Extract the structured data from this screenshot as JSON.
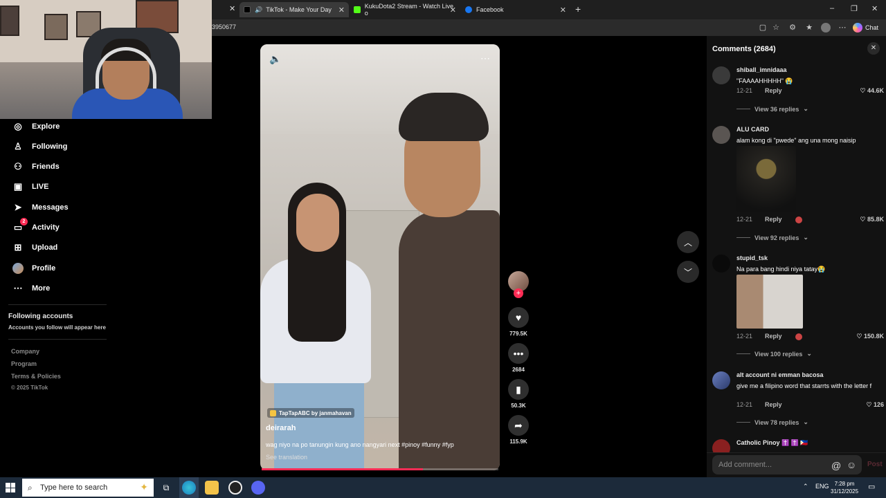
{
  "browser": {
    "tabs": [
      {
        "title": "TikTok - Make Your Day",
        "active": true
      },
      {
        "title": "KukuDota2 Stream - Watch Live o",
        "active": false
      },
      {
        "title": "Facebook",
        "active": false
      }
    ],
    "url_fragment": "3950677",
    "chat_label": "Chat",
    "new_tab_icon": "plus-icon"
  },
  "sidebar": {
    "items": [
      {
        "label": "Explore",
        "icon": "compass-icon"
      },
      {
        "label": "Following",
        "icon": "person-check-icon"
      },
      {
        "label": "Friends",
        "icon": "people-icon"
      },
      {
        "label": "LIVE",
        "icon": "live-tv-icon"
      },
      {
        "label": "Messages",
        "icon": "paper-plane-icon"
      },
      {
        "label": "Activity",
        "icon": "bell-message-icon",
        "badge": "2"
      },
      {
        "label": "Upload",
        "icon": "plus-square-icon"
      },
      {
        "label": "Profile",
        "icon": "profile-avatar-icon"
      },
      {
        "label": "More",
        "icon": "ellipsis-icon"
      }
    ],
    "following_title": "Following accounts",
    "following_sub": "Accounts you follow will appear here",
    "footer": {
      "company": "Company",
      "program": "Program",
      "terms": "Terms & Policies",
      "copyright": "© 2025 TikTok"
    }
  },
  "video": {
    "source_tag": "TapTapABC by janmahavan",
    "author": "deirarah",
    "caption": "wag niyo na po tanungin kung ano nangyari next #pinoy #funny #fyp",
    "see_translation": "See translation",
    "progress": 0.68
  },
  "actions": {
    "likes": "779.5K",
    "comments": "2684",
    "saves": "50.3K",
    "shares": "115.9K"
  },
  "comments": {
    "title": "Comments (2684)",
    "items": [
      {
        "user": "shiball_imnidaaa",
        "text": "\"FAAAAHHHHH\" 😭",
        "date": "12-21",
        "reply": "Reply",
        "likes": "44.6K",
        "view_replies": "View 36 replies"
      },
      {
        "user": "ALU CARD",
        "text": "alam kong di \"pwede\" ang una mong naisip",
        "date": "12-21",
        "reply": "Reply",
        "likes": "85.8K",
        "view_replies": "View 92 replies"
      },
      {
        "user": "stupid_tsk",
        "text": "Na para bang hindi niya tatay😭",
        "date": "12-21",
        "reply": "Reply",
        "likes": "150.8K",
        "view_replies": "View 100 replies"
      },
      {
        "user": "alt account ni emman bacosa",
        "text": "give me a filipino word that starrts with the letter f",
        "date": "12-21",
        "reply": "Reply",
        "likes": "126",
        "view_replies": "View 78 replies"
      },
      {
        "user": "Catholic Pinoy ✝️ ✝️ 🇵🇭"
      }
    ],
    "input_placeholder": "Add comment...",
    "post_label": "Post"
  },
  "taskbar": {
    "search_placeholder": "Type here to search",
    "lang": "ENG",
    "time": "7:28 pm",
    "date": "31/12/2025"
  }
}
